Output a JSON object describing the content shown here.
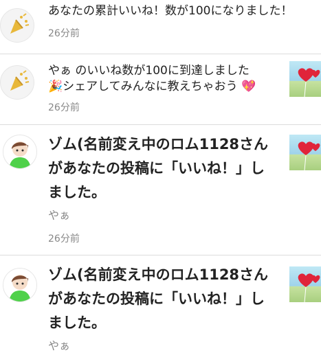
{
  "notifications": [
    {
      "icon": "party-popper-icon",
      "text_lines": [
        "あなたの累計いいね！数が100になりました！"
      ],
      "time": "26分前"
    },
    {
      "icon": "party-popper-icon",
      "text_lines": [
        "やぁ のいいね数が100に到達しました",
        "🎉シェアしてみんなに教えちゃおう 💖"
      ],
      "time": "26分前",
      "thumbnail": "heart-balloons-thumbnail"
    },
    {
      "avatar": "user-avatar",
      "text_lines": [
        "ゾム(名前変え中のロム1128さん",
        "があなたの投稿に「いいね！」し",
        "ました。"
      ],
      "post_text": "やぁ",
      "time": "26分前",
      "thumbnail": "heart-balloons-thumbnail"
    },
    {
      "avatar": "user-avatar",
      "text_lines": [
        "ゾム(名前変え中のロム1128さん",
        "があなたの投稿に「いいね！」し",
        "ました。"
      ],
      "post_text": "やぁ",
      "thumbnail": "heart-balloons-thumbnail"
    }
  ],
  "colors": {
    "divider": "#dcdcdc",
    "muted_text": "#888888",
    "icon_gold": "#e8b83a",
    "heart_red": "#e0243a"
  }
}
